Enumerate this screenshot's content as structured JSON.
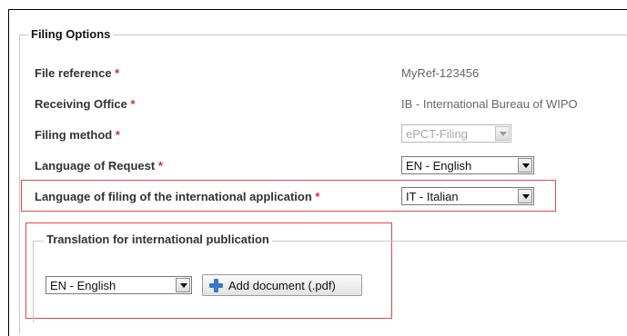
{
  "filing_options": {
    "legend": "Filing Options",
    "rows": [
      {
        "label": "File reference",
        "required": "*",
        "value": "MyRef-123456"
      },
      {
        "label": "Receiving Office",
        "required": "*",
        "value": "IB - International Bureau of WIPO"
      },
      {
        "label": "Filing method",
        "required": "*",
        "value": "ePCT-Filing"
      },
      {
        "label": "Language of Request",
        "required": "*",
        "value": "EN - English"
      },
      {
        "label": "Language of filing of the international application",
        "required": "*",
        "value": "IT - Italian"
      }
    ]
  },
  "translation": {
    "legend": "Translation for international publication",
    "language_value": "EN - English",
    "add_document_label": "Add document (.pdf)"
  },
  "colors": {
    "required": "#e0262b",
    "highlight_border": "#e04848",
    "add_icon": "#3a78c8"
  },
  "icons": [
    "chevron-down-icon",
    "plus-icon"
  ]
}
